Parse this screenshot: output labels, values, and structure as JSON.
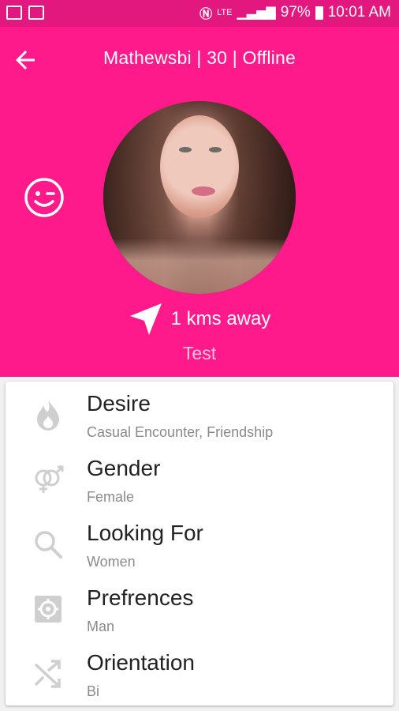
{
  "status_bar": {
    "battery": "97%",
    "time": "10:01 AM",
    "network": "LTE"
  },
  "header": {
    "title": "Mathewsbi | 30 | Offline",
    "distance": "1 kms away",
    "status_text": "Test"
  },
  "colors": {
    "accent": "#ff1a8c",
    "status_bar": "#e3187f",
    "icon_gray": "#c8c8c8"
  },
  "details": [
    {
      "label": "Desire",
      "value": "Casual Encounter, Friendship",
      "icon": "flame-icon"
    },
    {
      "label": "Gender",
      "value": "Female",
      "icon": "gender-symbols-icon"
    },
    {
      "label": "Looking For",
      "value": "Women",
      "icon": "search-icon"
    },
    {
      "label": "Prefrences",
      "value": "Man",
      "icon": "settings-icon"
    },
    {
      "label": "Orientation",
      "value": "Bi",
      "icon": "shuffle-icon"
    }
  ]
}
